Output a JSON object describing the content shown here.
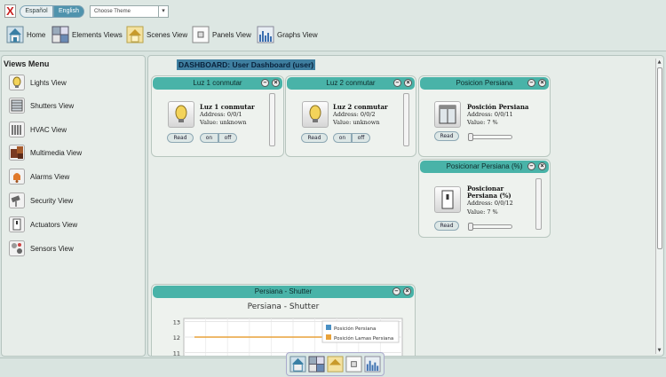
{
  "topbar": {
    "close_glyph": "X",
    "lang_es": "Español",
    "lang_en": "English",
    "theme_placeholder": "Choose Theme",
    "nav": [
      {
        "label": "Home",
        "icon": "house-icon"
      },
      {
        "label": "Elements Views",
        "icon": "elements-icon"
      },
      {
        "label": "Scenes View",
        "icon": "scenes-icon"
      },
      {
        "label": "Panels View",
        "icon": "panel-icon"
      },
      {
        "label": "Graphs View",
        "icon": "graph-icon"
      }
    ]
  },
  "menu": {
    "title": "Views Menu",
    "items": [
      {
        "label": "Lights View",
        "icon": "bulb-icon"
      },
      {
        "label": "Shutters View",
        "icon": "shutter-icon"
      },
      {
        "label": "HVAC View",
        "icon": "radiator-icon"
      },
      {
        "label": "Multimedia View",
        "icon": "multimedia-icon"
      },
      {
        "label": "Alarms View",
        "icon": "bell-icon"
      },
      {
        "label": "Security View",
        "icon": "camera-icon"
      },
      {
        "label": "Actuators View",
        "icon": "switch-icon"
      },
      {
        "label": "Sensors View",
        "icon": "sensor-icon"
      }
    ]
  },
  "dashboard": {
    "title": "DASHBOARD: User Dashboard (user)",
    "widgets": {
      "luz1": {
        "title": "Luz 1 conmutar",
        "name": "Luz 1 conmutar",
        "address": "Address: 0/0/1",
        "value": "Value: unknown",
        "read": "Read",
        "on": "on",
        "off": "off"
      },
      "luz2": {
        "title": "Luz 2 conmutar",
        "name": "Luz 2 conmutar",
        "address": "Address: 0/0/2",
        "value": "Value: unknown",
        "read": "Read",
        "on": "on",
        "off": "off"
      },
      "posicion": {
        "title": "Posicion Persiana",
        "name": "Posición Persiana",
        "address": "Address: 0/0/11",
        "value": "Value: 7 %",
        "read": "Read",
        "level_percent": 0
      },
      "posicionar": {
        "title": "Posicionar Persiana (%)",
        "name_line1": "Posicionar",
        "name_line2": "Persiana (%)",
        "address": "Address: 0/0/12",
        "value": "Value: 7 %",
        "read": "Read",
        "level_percent": 0
      },
      "chartwidget": {
        "title": "Persiana - Shutter"
      }
    },
    "minimize_glyph": "–",
    "close_glyph": "×"
  },
  "chart_data": {
    "type": "line",
    "title": "Persiana - Shutter",
    "xlabel": "",
    "ylabel": "",
    "y_ticks_visible": [
      13,
      12,
      11
    ],
    "grid": true,
    "legend_position": "top-right",
    "series": [
      {
        "name": "Posición Persiana",
        "color": "#4a90c4",
        "values": [
          12,
          12,
          12,
          12,
          12,
          12,
          12,
          12,
          12,
          12
        ]
      },
      {
        "name": "Posición Lamas Persiana",
        "color": "#e8a23a",
        "values": [
          12,
          12,
          12,
          12,
          12,
          12,
          12,
          12,
          12,
          12
        ]
      }
    ]
  },
  "colors": {
    "widget_header": "#49b3a8",
    "dashboard_title_bg": "#3f7fa0",
    "accent_lang": "#4f93ad"
  }
}
